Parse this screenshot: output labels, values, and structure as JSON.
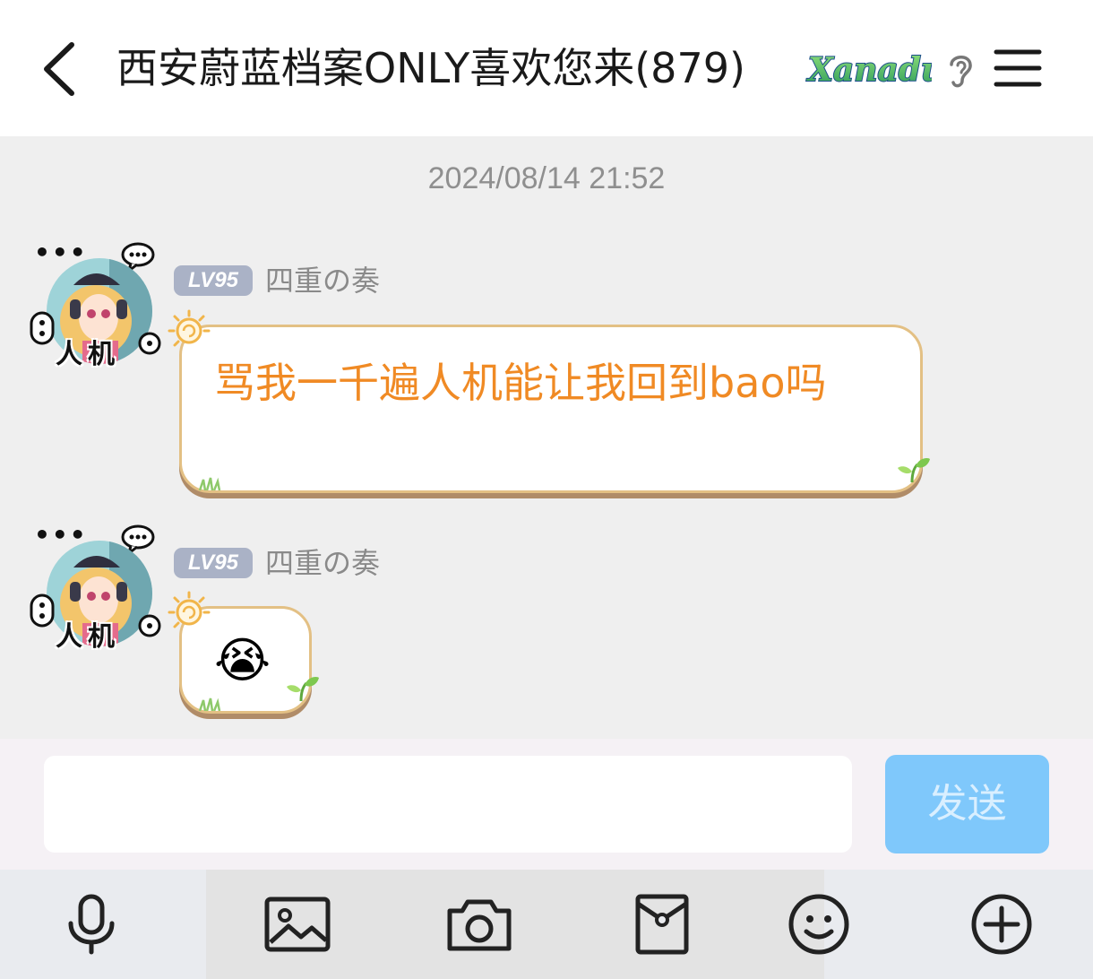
{
  "header": {
    "title": "西安蔚蓝档案ONLY喜欢您来(879)",
    "brand_logo_text": "Xanadu",
    "back_icon": "chevron-left-icon",
    "ear_icon": "ear-icon",
    "menu_icon": "hamburger-menu-icon"
  },
  "chat": {
    "timestamp": "2024/08/14 21:52",
    "messages": [
      {
        "level": "LV95",
        "sender": "四重の奏",
        "avatar_tag": "人机",
        "text": "骂我一千遍人机能让我回到bao吗"
      },
      {
        "level": "LV95",
        "sender": "四重の奏",
        "avatar_tag": "人机",
        "emoji": "😭"
      }
    ]
  },
  "input": {
    "placeholder": "",
    "value": "",
    "send_label": "发送"
  },
  "toolbar": {
    "items": [
      "microphone-icon",
      "image-icon",
      "camera-icon",
      "red-packet-icon",
      "emoji-icon",
      "plus-circle-icon"
    ]
  },
  "colors": {
    "accent_send": "#7fc8fb",
    "bubble_text": "#f08a24",
    "bubble_border": "#e3c084",
    "level_badge": "#aab2c6"
  }
}
